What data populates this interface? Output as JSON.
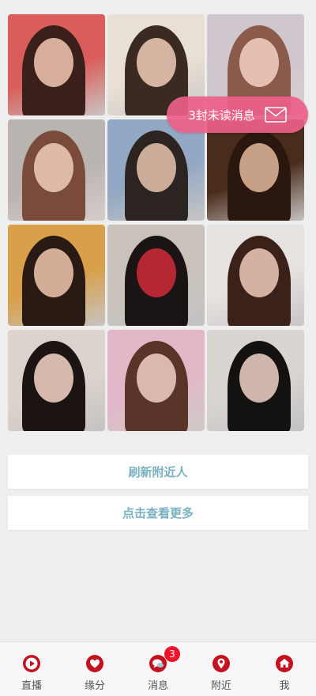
{
  "colors": {
    "accent": "#7ab2c2",
    "unread_bg": "#ec6088",
    "tab_icon": "#c4101f",
    "badge": "#f0132a"
  },
  "photos": [
    {
      "alt": "user-photo-1",
      "palette": [
        "#d95d5a",
        "#3a1f1a",
        "#f3c9b4"
      ]
    },
    {
      "alt": "user-photo-2",
      "palette": [
        "#e8e0d4",
        "#3a2a22",
        "#f1cdb8"
      ]
    },
    {
      "alt": "user-photo-3",
      "palette": [
        "#cfc6ce",
        "#8a5a4a",
        "#f4d2c4"
      ]
    },
    {
      "alt": "user-photo-4",
      "palette": [
        "#b9b4b0",
        "#7a4a3a",
        "#f0cdb8"
      ]
    },
    {
      "alt": "user-photo-5",
      "palette": [
        "#93a8c4",
        "#2c2420",
        "#e8c4ae"
      ]
    },
    {
      "alt": "user-photo-6",
      "palette": [
        "#4a2c1c",
        "#2a1810",
        "#e2b89c"
      ]
    },
    {
      "alt": "user-photo-7",
      "palette": [
        "#d8a04a",
        "#2a1a14",
        "#f2c8b0"
      ]
    },
    {
      "alt": "user-photo-8",
      "palette": [
        "#c8c2ba",
        "#1a1414",
        "#d22a3a"
      ]
    },
    {
      "alt": "user-photo-9",
      "palette": [
        "#e6e2e0",
        "#3a221a",
        "#f0cab8"
      ]
    },
    {
      "alt": "user-photo-10",
      "palette": [
        "#dcd4cc",
        "#1c1412",
        "#f4d6c8"
      ]
    },
    {
      "alt": "user-photo-11",
      "palette": [
        "#e2b8c8",
        "#5a3428",
        "#f2d0c4"
      ]
    },
    {
      "alt": "user-photo-12",
      "palette": [
        "#d8d4d0",
        "#141210",
        "#f0d4c8"
      ]
    }
  ],
  "unread": {
    "text": "3封未读消息",
    "icon": "mail-icon"
  },
  "buttons": {
    "refresh": "刷新附近人",
    "more": "点击查看更多"
  },
  "tabs": [
    {
      "key": "live",
      "label": "直播",
      "icon": "play-icon"
    },
    {
      "key": "fate",
      "label": "缘分",
      "icon": "heart-icon"
    },
    {
      "key": "messages",
      "label": "消息",
      "icon": "chat-icon",
      "badge": "3"
    },
    {
      "key": "nearby",
      "label": "附近",
      "icon": "location-icon"
    },
    {
      "key": "me",
      "label": "我",
      "icon": "home-icon"
    }
  ]
}
